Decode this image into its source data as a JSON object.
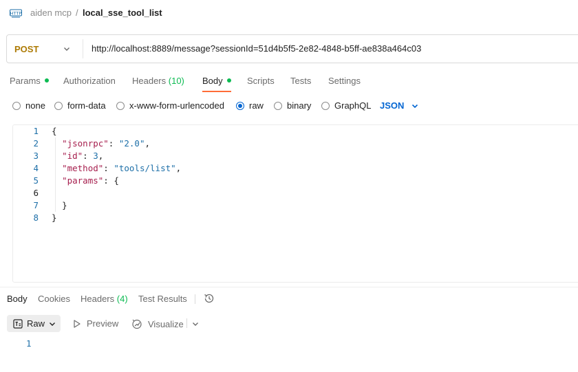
{
  "breadcrumb": {
    "icon": "http-icon",
    "parent": "aiden mcp",
    "separator": "/",
    "title": "local_sse_tool_list"
  },
  "request": {
    "method": "POST",
    "url": "http://localhost:8889/message?sessionId=51d4b5f5-2e82-4848-b5ff-ae838a464c03"
  },
  "request_tabs": [
    {
      "label": "Params",
      "dot": true
    },
    {
      "label": "Authorization"
    },
    {
      "label": "Headers",
      "count": "(10)"
    },
    {
      "label": "Body",
      "dot": true,
      "active": true
    },
    {
      "label": "Scripts"
    },
    {
      "label": "Tests"
    },
    {
      "label": "Settings"
    }
  ],
  "body_types": {
    "options": [
      "none",
      "form-data",
      "x-www-form-urlencoded",
      "raw",
      "binary",
      "GraphQL"
    ],
    "selected": "raw",
    "format": "JSON"
  },
  "editor": {
    "line_numbers": [
      "1",
      "2",
      "3",
      "4",
      "5",
      "6",
      "7",
      "8"
    ],
    "current_line": "6",
    "tokens": {
      "open_brace": "{",
      "key_jsonrpc": "\"jsonrpc\"",
      "val_jsonrpc": "\"2.0\"",
      "key_id": "\"id\"",
      "val_id": "3",
      "key_method": "\"method\"",
      "val_method": "\"tools/list\"",
      "key_params": "\"params\"",
      "params_open": "{",
      "params_close": "}",
      "close_brace": "}",
      "colon": ": ",
      "comma": ","
    }
  },
  "response": {
    "tabs": [
      {
        "label": "Body",
        "active": true
      },
      {
        "label": "Cookies"
      },
      {
        "label": "Headers",
        "count": "(4)"
      },
      {
        "label": "Test Results"
      }
    ],
    "view_mode": "Raw",
    "preview_label": "Preview",
    "visualize_label": "Visualize",
    "line_number": "1"
  },
  "colors": {
    "method": "#ad7a03",
    "accent": "#ff6c37",
    "green": "#0cbb52",
    "blue": "#0265d2"
  }
}
